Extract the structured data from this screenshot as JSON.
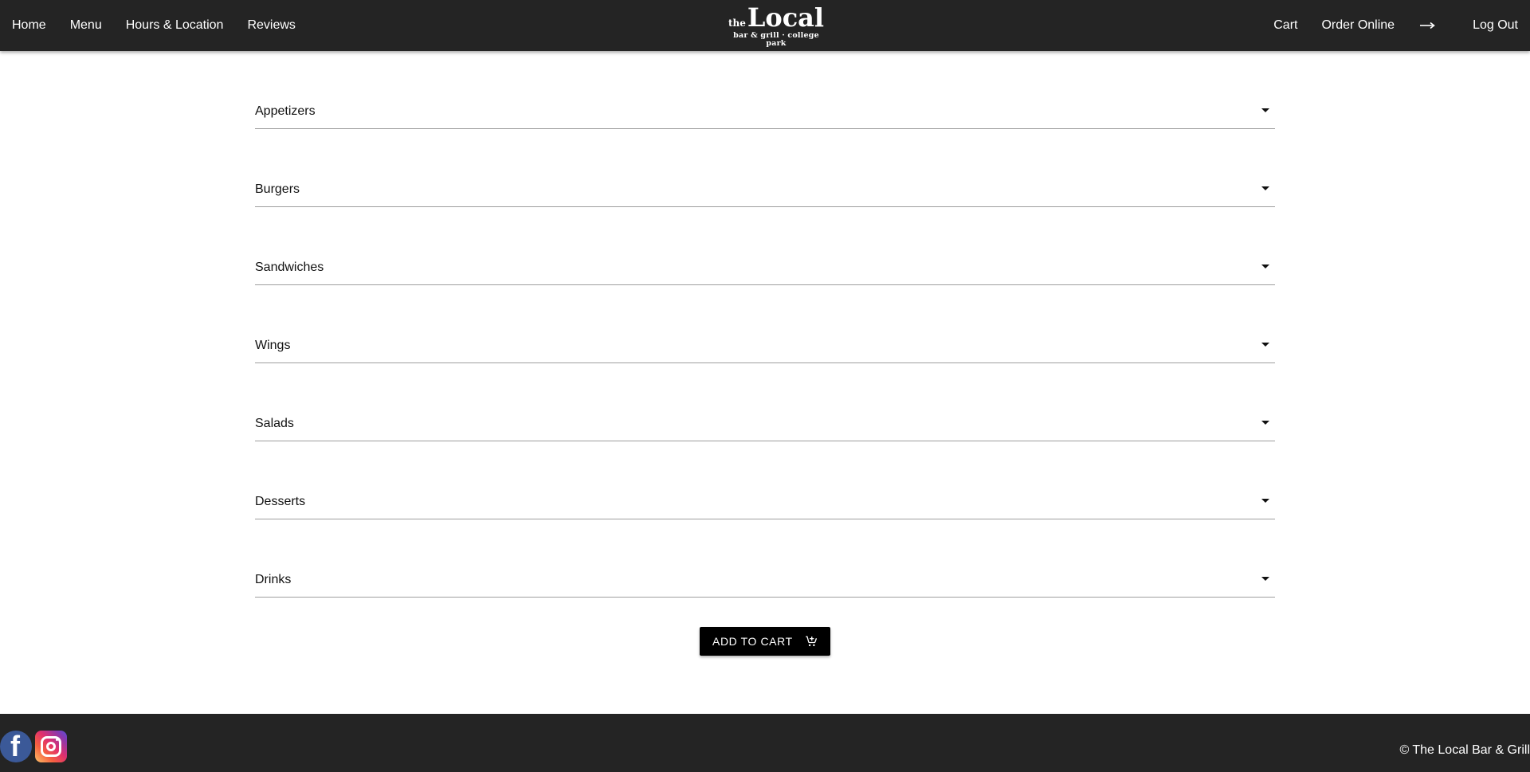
{
  "header": {
    "nav_left": [
      "Home",
      "Menu",
      "Hours & Location",
      "Reviews"
    ],
    "logo": {
      "the": "the",
      "name": "Local",
      "tagline": "bar & grill · college park"
    },
    "nav_right": {
      "cart": "Cart",
      "order_online": "Order Online",
      "logout": "Log Out",
      "logout_icon": "arrow-right-icon"
    }
  },
  "menu_sections": [
    {
      "label": "Appetizers",
      "icon": "caret-down-icon"
    },
    {
      "label": "Burgers",
      "icon": "caret-down-icon"
    },
    {
      "label": "Sandwiches",
      "icon": "caret-down-icon"
    },
    {
      "label": "Wings",
      "icon": "caret-down-icon"
    },
    {
      "label": "Salads",
      "icon": "caret-down-icon"
    },
    {
      "label": "Desserts",
      "icon": "caret-down-icon"
    },
    {
      "label": "Drinks",
      "icon": "caret-down-icon"
    }
  ],
  "add_to_cart": {
    "label": "ADD TO CART",
    "icon": "add-shopping-cart-icon"
  },
  "footer": {
    "social": [
      "facebook-icon",
      "instagram-icon"
    ],
    "copyright": "© The Local Bar & Grill"
  },
  "colors": {
    "header_bg": "#242424",
    "footer_bg": "#242424",
    "button_bg": "#000000",
    "divider": "#9e9e9e"
  }
}
